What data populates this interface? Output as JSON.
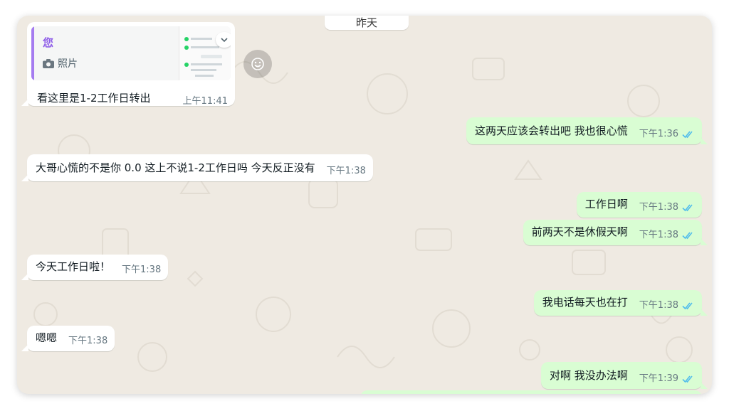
{
  "date_chip": "昨天",
  "quoted_message": {
    "author": "您",
    "type_label": "照片",
    "text": "看这里是1-2工作日转出",
    "time": "上午11:41"
  },
  "messages": [
    {
      "dir": "out",
      "text": "这两天应该会转出吧 我也很心慌",
      "time": "下午1:36",
      "read": true
    },
    {
      "dir": "in",
      "text": "大哥心慌的不是你 0.0 这上不说1-2工作日吗 今天反正没有",
      "time": "下午1:38"
    },
    {
      "dir": "out",
      "text": "工作日啊",
      "time": "下午1:38",
      "read": true
    },
    {
      "dir": "out",
      "text": "前两天不是休假天啊",
      "time": "下午1:38",
      "read": true
    },
    {
      "dir": "in",
      "text": "今天工作日啦！",
      "time": "下午1:38"
    },
    {
      "dir": "out",
      "text": "我电话每天也在打",
      "time": "下午1:38",
      "read": true
    },
    {
      "dir": "in",
      "text": "嗯嗯",
      "time": "下午1:38"
    },
    {
      "dir": "out",
      "text": "对啊 我没办法啊",
      "time": "下午1:39",
      "read": true
    }
  ],
  "colors": {
    "wallpaper": "#efeae2",
    "incoming": "#ffffff",
    "outgoing": "#d9fdd3",
    "read_ticks": "#53bdeb",
    "quote_accent": "#a57cf0"
  },
  "icons": {
    "camera": "camera-icon",
    "dropdown": "chevron-down-icon",
    "emoji": "emoji-react-icon",
    "ticks": "double-check-icon"
  }
}
